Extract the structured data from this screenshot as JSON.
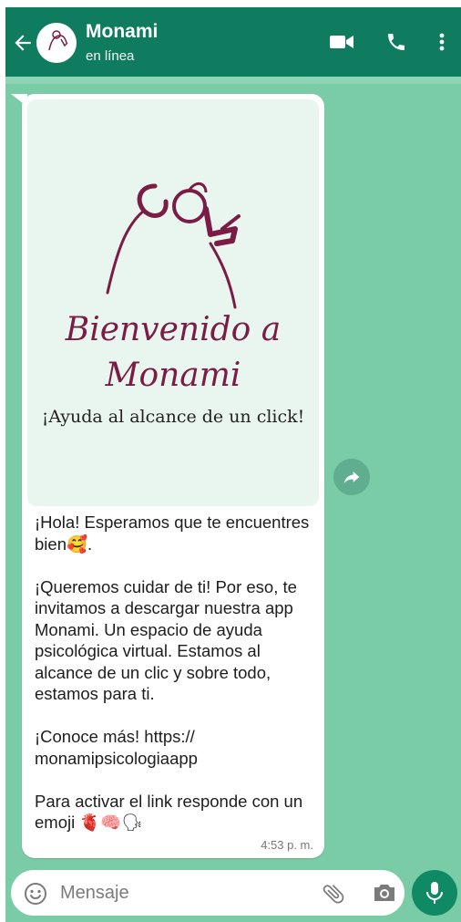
{
  "header": {
    "title": "Monami",
    "status": "en línea",
    "avatar_text": "Monami",
    "icons": [
      "back-arrow-icon",
      "video-call-icon",
      "phone-icon",
      "more-vert-icon"
    ]
  },
  "message": {
    "image": {
      "welcome_line1": "Bienvenido a",
      "welcome_line2": "Monami",
      "tagline": "¡Ayuda al alcance de un click!"
    },
    "paragraphs": [
      {
        "text": "¡Hola! Esperamos que te encuentres bien",
        "emoji": "🥰"
      },
      {
        "text": "¡Queremos cuidar de ti! Por eso, te invitamos a descargar nuestra app Monami. Un espacio de ayuda psicológica virtual. Estamos al alcance de un clic y sobre todo, estamos para ti."
      },
      {
        "text": "¡Conoce más! https:// monamipsicologiaapp"
      },
      {
        "text": "Para activar el link responde con un emoji",
        "emoji": "🫀🧠🗣"
      }
    ],
    "time": "4:53 p. m."
  },
  "composer": {
    "placeholder": "Mensaje",
    "icons": [
      "emoji-icon",
      "attach-icon",
      "camera-icon",
      "mic-icon"
    ]
  },
  "colors": {
    "header": "#0f7c5f",
    "chat_background": "#79cca6",
    "brand": "#7b1c45",
    "mic_button": "#0f8a65"
  }
}
